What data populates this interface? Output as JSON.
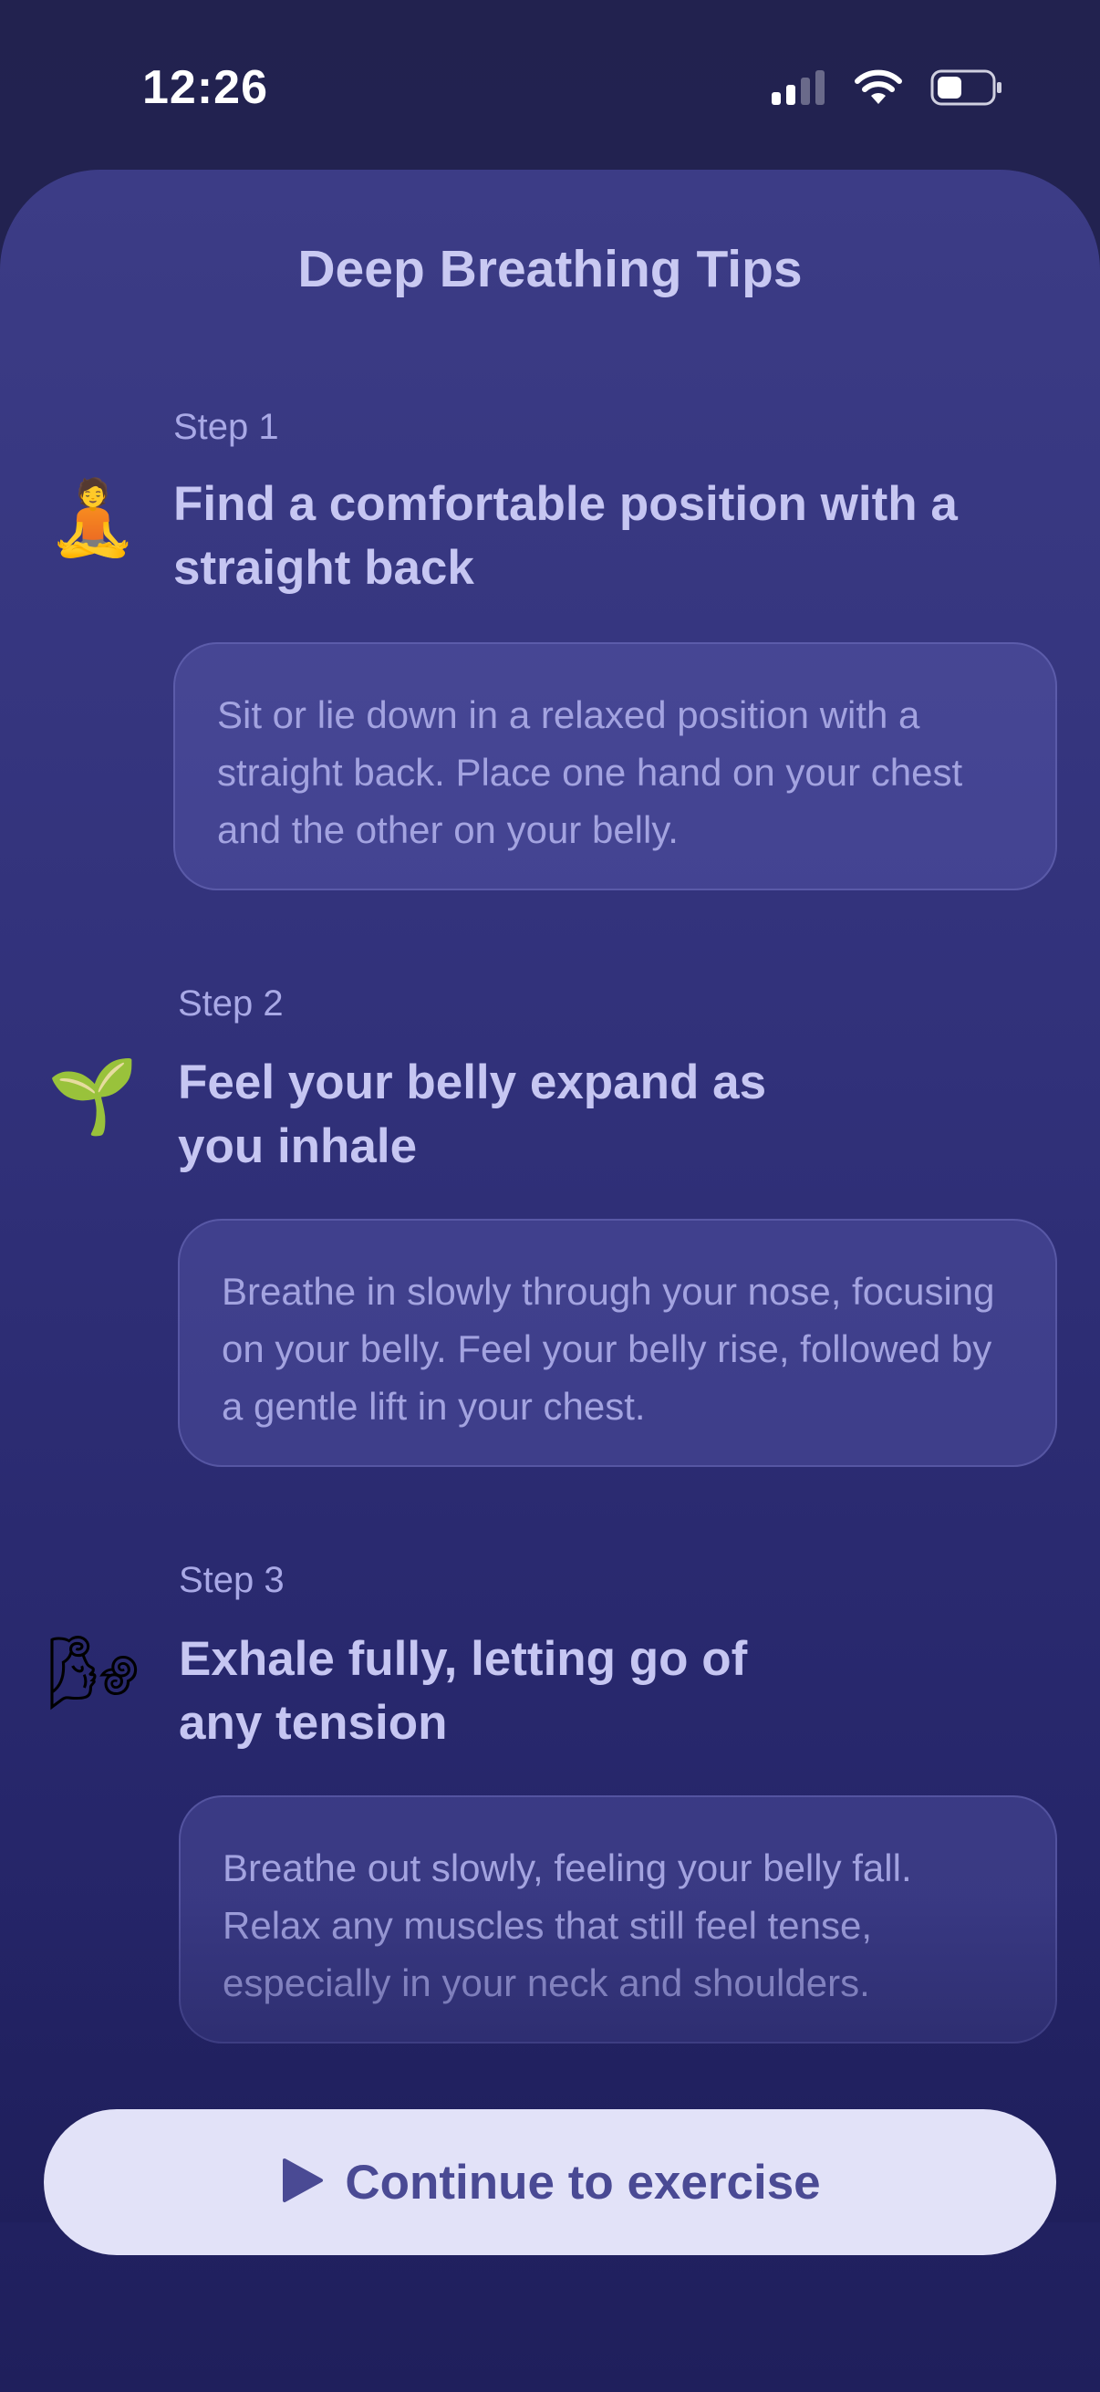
{
  "status_bar": {
    "time": "12:26"
  },
  "sheet": {
    "title": "Deep Breathing Tips"
  },
  "steps": [
    {
      "label": "Step 1",
      "emoji": "🧘",
      "icon": "meditation-icon",
      "heading": "Find a comfortable position with a straight back",
      "description": "Sit or lie down in a relaxed position with a straight back. Place one hand on your chest and the other on your belly."
    },
    {
      "label": "Step 2",
      "emoji": "🌱",
      "icon": "seedling-icon",
      "heading": "Feel your belly expand as you inhale",
      "description": "Breathe in slowly through your nose, focusing on your belly. Feel your belly rise, followed by a gentle lift in your chest."
    },
    {
      "label": "Step 3",
      "emoji": "🌬",
      "icon": "wind-icon",
      "heading": "Exhale fully, letting go of any tension",
      "description": "Breathe out slowly, feeling your belly fall. Relax any muscles that still feel tense, especially in your neck and shoulders."
    }
  ],
  "cta": {
    "label": "Continue to exercise",
    "icon": "play-icon"
  },
  "colors": {
    "background": "#1f1f55",
    "sheet_top": "#3c3c86",
    "title": "#c9c9f2",
    "card_text": "#a3a3e0",
    "button_bg": "#e2e2f8",
    "button_text": "#4a4a94"
  }
}
